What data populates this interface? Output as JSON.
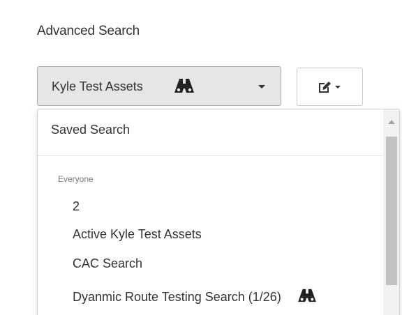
{
  "page": {
    "title": "Advanced Search"
  },
  "saved_search_select": {
    "selected_value": "Kyle Test Assets",
    "icon": "binoculars-icon",
    "caret_icon": "chevron-down-icon"
  },
  "edit_menu_button": {
    "icon": "edit-icon",
    "caret_icon": "chevron-down-icon"
  },
  "dropdown": {
    "header": "Saved Search",
    "groups": [
      {
        "label": "Everyone",
        "items": [
          {
            "label": "2",
            "shared": false
          },
          {
            "label": "Active Kyle Test Assets",
            "shared": false
          },
          {
            "label": "CAC Search",
            "shared": false
          },
          {
            "label": "Dyanmic Route Testing Search (1/26)",
            "shared": true,
            "icon": "binoculars-icon"
          }
        ]
      }
    ]
  },
  "colors": {
    "select_background": "#e6e6e6",
    "select_border": "#adadad",
    "text": "#333333",
    "muted_text": "#777777",
    "scrollbar_track": "#f1f1f1",
    "scrollbar_thumb": "#c1c1c1"
  }
}
